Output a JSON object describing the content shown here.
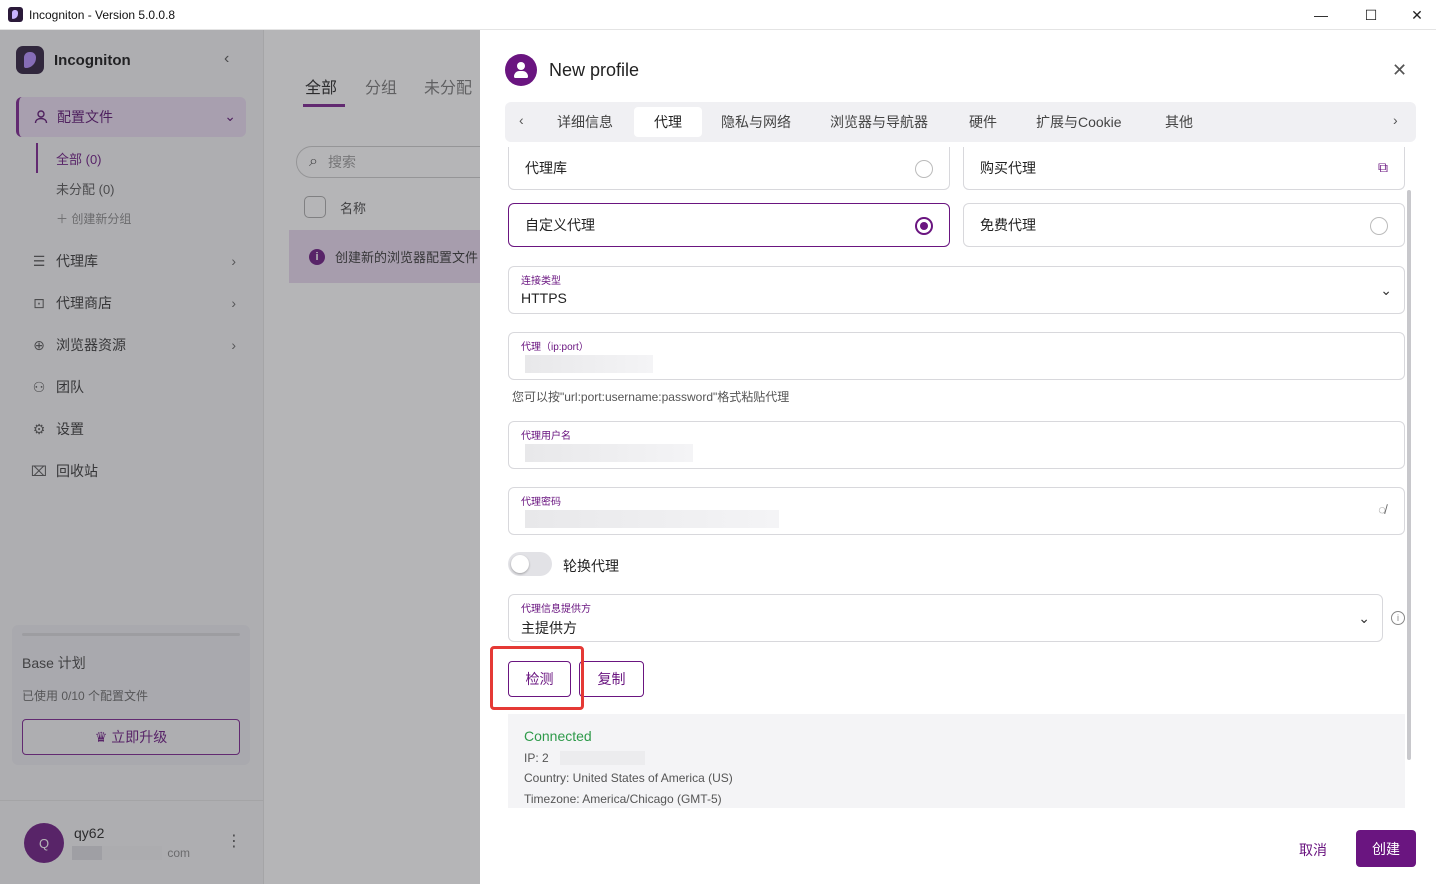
{
  "window": {
    "title": "Incogniton - Version 5.0.0.8",
    "min": "—",
    "max": "☐",
    "close": "✕"
  },
  "sidebar": {
    "brand": "Incogniton",
    "collapse": "‹",
    "active": {
      "label": "配置文件",
      "chevron": "⌄"
    },
    "sub": [
      {
        "label": "全部 (0)"
      },
      {
        "label": "未分配 (0)"
      }
    ],
    "add_group": "＋ 创建新分组",
    "items": [
      {
        "label": "代理库",
        "icon": "list-icon",
        "glyph": "☰",
        "chevron": "›"
      },
      {
        "label": "代理商店",
        "icon": "store-icon",
        "glyph": "⊡",
        "chevron": "›"
      },
      {
        "label": "浏览器资源",
        "icon": "globe-icon",
        "glyph": "⊕",
        "chevron": "›"
      },
      {
        "label": "团队",
        "icon": "team-icon",
        "glyph": "⚇",
        "chevron": ""
      },
      {
        "label": "设置",
        "icon": "gear-icon",
        "glyph": "⚙",
        "chevron": ""
      },
      {
        "label": "回收站",
        "icon": "trash-icon",
        "glyph": "⌧",
        "chevron": ""
      }
    ],
    "plan": {
      "name": "Base 计划",
      "usage": "已使用 0/10 个配置文件",
      "upgrade": "♛ 立即升级"
    },
    "user": {
      "avatar": "Q",
      "name": "qy62",
      "email": "com",
      "more": "⋮"
    }
  },
  "main": {
    "tabs": [
      "全部",
      "分组",
      "未分配"
    ],
    "search_placeholder": "搜索",
    "search_icon": "⌕",
    "col_name": "名称",
    "banner_icon": "i",
    "banner": "创建新的浏览器配置文件"
  },
  "dialog": {
    "title": "New profile",
    "close": "✕",
    "tabs": [
      "详细信息",
      "代理",
      "隐私与网络",
      "浏览器与导航器",
      "硬件",
      "扩展与Cookie",
      "其他"
    ],
    "active_tab": "代理",
    "tab_prev": "‹",
    "tab_next": "›",
    "options": {
      "proxy_lib": "代理库",
      "buy_proxy": "购买代理",
      "custom_proxy": "自定义代理",
      "free_proxy": "免费代理",
      "ext_icon": "⧉"
    },
    "connection": {
      "label": "连接类型",
      "value": "HTTPS",
      "chevron": "⌄"
    },
    "proxy": {
      "label": "代理（ip:port）"
    },
    "hint": "您可以按\"url:port:username:password\"格式粘贴代理",
    "username": {
      "label": "代理用户名"
    },
    "password": {
      "label": "代理密码",
      "eye": "◌̸"
    },
    "rotate": "轮换代理",
    "provider": {
      "label": "代理信息提供方",
      "value": "主提供方",
      "chevron": "⌄",
      "info": "i"
    },
    "check": "检测",
    "copy": "复制",
    "result": {
      "status": "Connected",
      "ip": "IP:  2",
      "country": "Country:  United States of America (US)",
      "timezone": "Timezone:  America/Chicago (GMT-5)"
    },
    "cancel": "取消",
    "create": "创建"
  },
  "colors": {
    "accent": "#6a1580",
    "success": "#2e9a4a",
    "highlight": "#e53935"
  }
}
